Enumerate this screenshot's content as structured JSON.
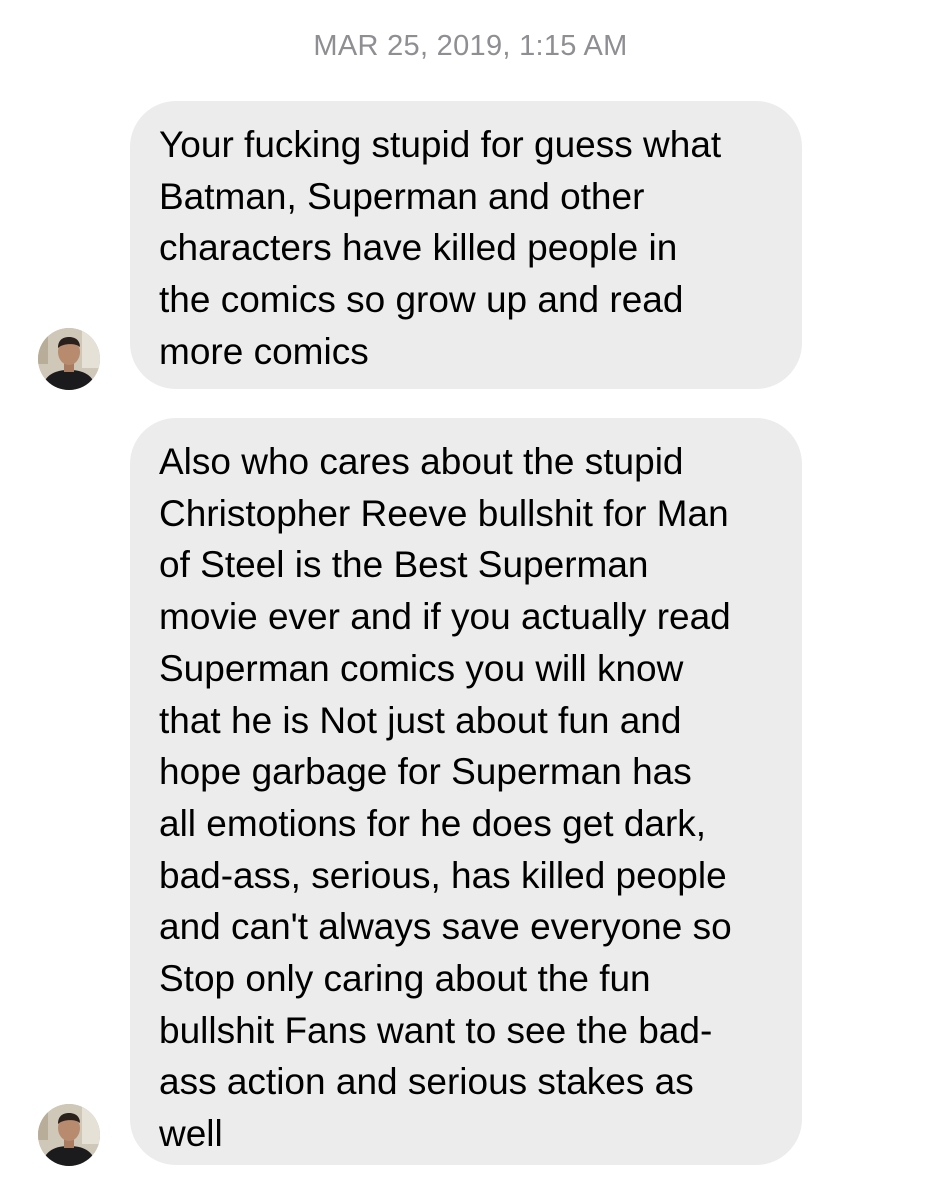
{
  "conversation": {
    "timestamp": "MAR 25, 2019, 1:15 AM",
    "messages": [
      {
        "sender": "incoming",
        "avatar_icon": "user-avatar-icon",
        "text": "Your fucking stupid for guess what\nBatman, Superman and other\ncharacters have killed people in\nthe comics so grow up and read\nmore comics"
      },
      {
        "sender": "incoming",
        "avatar_icon": "user-avatar-icon",
        "text": "Also who cares about the stupid\nChristopher Reeve bullshit for Man\nof Steel is the Best Superman\nmovie ever and if you actually read\nSuperman comics you will know\nthat he is Not just about fun and\nhope garbage for Superman has\nall emotions for he does get dark,\nbad-ass, serious, has killed people\nand can't always save everyone so\nStop only caring about the fun\nbullshit Fans want to see the bad-\nass action and serious stakes as\nwell"
      }
    ]
  },
  "colors": {
    "bubble_background": "#ececec",
    "timestamp_text": "#8e8e93",
    "message_text": "#000000"
  }
}
